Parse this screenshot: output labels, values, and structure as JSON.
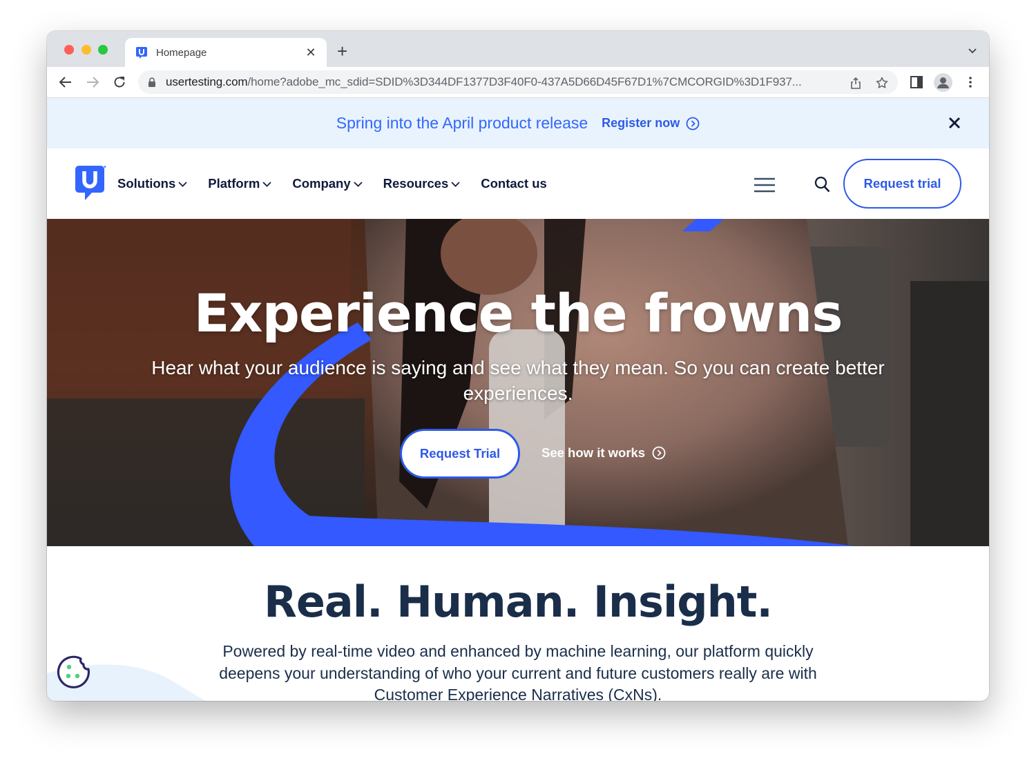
{
  "browser": {
    "tab": {
      "title": "Homepage",
      "favicon": "usertesting-logo-icon"
    },
    "new_tab_label": "+",
    "url": {
      "host": "usertesting.com",
      "rest": "/home?adobe_mc_sdid=SDID%3D344DF1377D3F40F0-437A5D66D45F67D1%7CMCORGID%3D1F937..."
    },
    "icons": [
      "back-icon",
      "forward-icon",
      "reload-icon",
      "lock-icon",
      "share-icon",
      "star-icon",
      "side-panel-icon",
      "profile-icon",
      "more-icon"
    ]
  },
  "banner": {
    "text": "Spring into the April product release",
    "link": "Register now",
    "color": "#3366ff"
  },
  "nav": {
    "menu": [
      {
        "label": "Solutions",
        "has_dropdown": true
      },
      {
        "label": "Platform",
        "has_dropdown": true
      },
      {
        "label": "Company",
        "has_dropdown": true
      },
      {
        "label": "Resources",
        "has_dropdown": true
      },
      {
        "label": "Contact us",
        "has_dropdown": false
      }
    ],
    "cta": "Request trial",
    "accent": "#2e5ae6",
    "text_color": "#0f1a3c"
  },
  "hero": {
    "title": "Experience the frowns",
    "subtitle": "Hear what your audience is saying and see what they mean. So you can create better experiences.",
    "cta_primary": "Request Trial",
    "cta_secondary": "See how it works"
  },
  "insight": {
    "title": "Real. Human. Insight.",
    "body": "Powered by real-time video and enhanced by machine learning, our platform quickly deepens your understanding of who your current and future customers really are with Customer Experience Narratives (CxNs).",
    "color": "#1a2e4a"
  }
}
